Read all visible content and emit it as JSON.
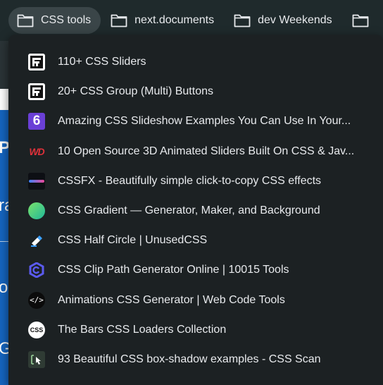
{
  "bookmarks_bar": {
    "folders": [
      {
        "label": "CSS tools",
        "icon": "folder-icon",
        "active": true
      },
      {
        "label": "next.documents",
        "icon": "folder-icon"
      },
      {
        "label": "dev Weekends",
        "icon": "folder-icon"
      },
      {
        "label": "",
        "icon": "folder-icon"
      }
    ]
  },
  "menu": {
    "items": [
      {
        "label": "110+ CSS Sliders",
        "icon": "freefrontend-icon"
      },
      {
        "label": "20+ CSS Group (Multi) Buttons",
        "icon": "freefrontend-icon"
      },
      {
        "label": "Amazing CSS Slideshow Examples You Can Use In Your...",
        "icon": "six-icon"
      },
      {
        "label": "10 Open Source 3D Animated Sliders Built On CSS & Jav...",
        "icon": "wd-icon"
      },
      {
        "label": "CSSFX - Beautifully simple click-to-copy CSS effects",
        "icon": "cssfx-icon"
      },
      {
        "label": "CSS Gradient — Generator, Maker, and Background",
        "icon": "gradient-icon"
      },
      {
        "label": "CSS Half Circle | UnusedCSS",
        "icon": "unusedcss-icon"
      },
      {
        "label": "CSS Clip Path Generator Online | 10015 Tools",
        "icon": "tools10015-icon"
      },
      {
        "label": "Animations CSS Generator | Web Code Tools",
        "icon": "code-icon"
      },
      {
        "label": "The Bars CSS Loaders Collection",
        "icon": "css-loaders-icon"
      },
      {
        "label": "93 Beautiful CSS box-shadow examples - CSS Scan",
        "icon": "css-scan-icon"
      }
    ]
  },
  "page_behind": {
    "letters": [
      "Pa",
      "ra",
      "o",
      "G"
    ]
  }
}
